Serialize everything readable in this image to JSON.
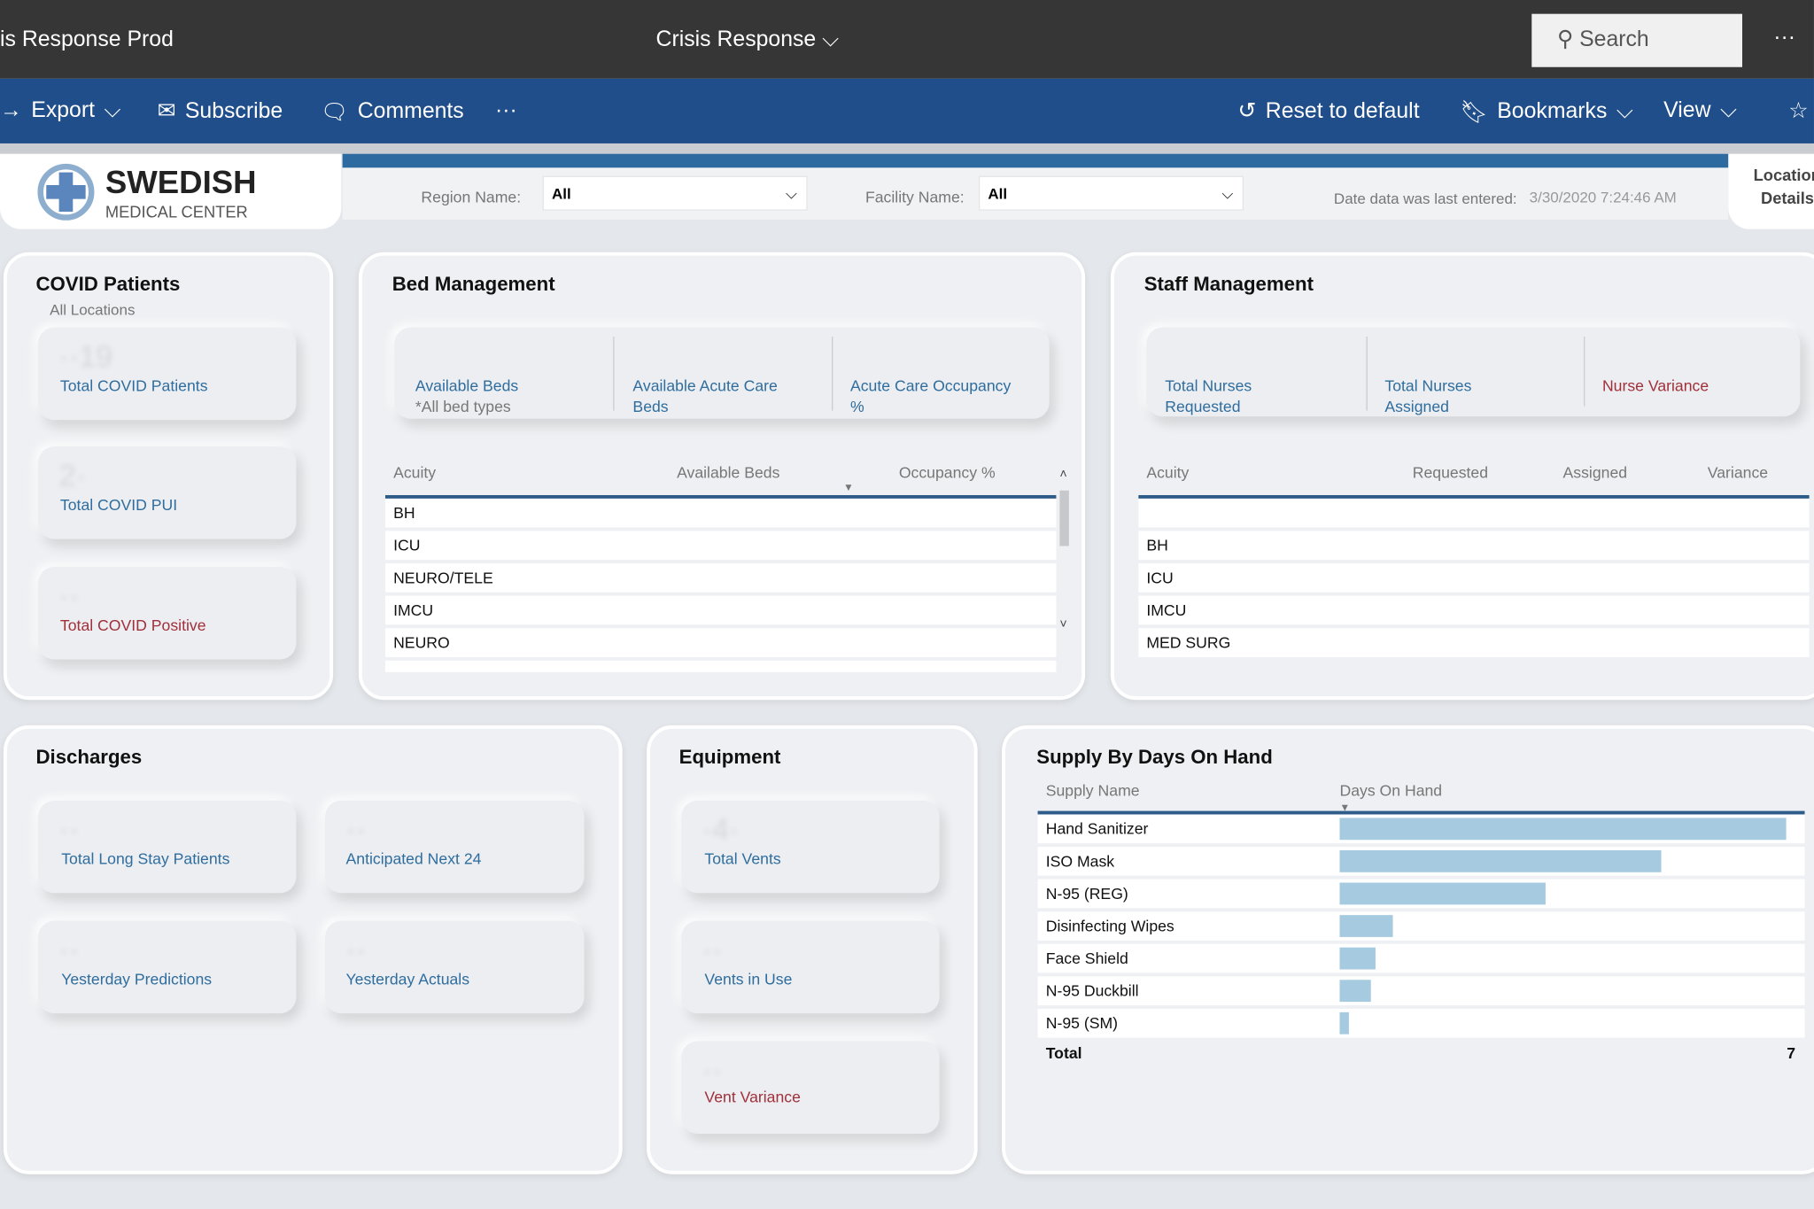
{
  "app": {
    "title": "is Response Prod",
    "report_title": "Crisis Response",
    "search_placeholder": "Search",
    "more": "···"
  },
  "toolbar": {
    "export": "Export",
    "subscribe": "Subscribe",
    "comments": "Comments",
    "more": "···",
    "reset": "Reset to default",
    "bookmarks": "Bookmarks",
    "view": "View"
  },
  "logo": {
    "name": "SWEDISH",
    "sub": "MEDICAL CENTER"
  },
  "filters": {
    "region_label": "Region Name:",
    "region_value": "All",
    "facility_label": "Facility Name:",
    "facility_value": "All",
    "date_label": "Date data was last entered:",
    "date_value": "3/30/2020 7:24:46 AM",
    "location_details_1": "Location",
    "location_details_2": "Details"
  },
  "covid": {
    "title": "COVID Patients",
    "subtitle": "All Locations",
    "cards": [
      "Total COVID Patients",
      "Total COVID PUI",
      "Total COVID Positive"
    ]
  },
  "bed": {
    "title": "Bed Management",
    "kpis": [
      {
        "l1": "Available Beds",
        "l2": "*All bed types"
      },
      {
        "l1": "Available Acute Care",
        "l2": "Beds"
      },
      {
        "l1": "Acute Care Occupancy",
        "l2": "%"
      }
    ],
    "columns": [
      "Acuity",
      "Available Beds",
      "Occupancy %"
    ],
    "rows": [
      "BH",
      "ICU",
      "NEURO/TELE",
      "IMCU",
      "NEURO"
    ]
  },
  "staff": {
    "title": "Staff Management",
    "kpis": [
      {
        "l1": "Total Nurses",
        "l2": "Requested"
      },
      {
        "l1": "Total Nurses",
        "l2": "Assigned"
      },
      {
        "l1": "Nurse Variance",
        "l2": ""
      }
    ],
    "columns": [
      "Acuity",
      "Requested",
      "Assigned",
      "Variance"
    ],
    "rows": [
      "",
      "BH",
      "ICU",
      "IMCU",
      "MED SURG"
    ]
  },
  "discharges": {
    "title": "Discharges",
    "cards": [
      "Total Long Stay Patients",
      "Anticipated Next 24",
      "Yesterday Predictions",
      "Yesterday Actuals"
    ]
  },
  "equipment": {
    "title": "Equipment",
    "cards": [
      "Total Vents",
      "Vents in Use",
      "Vent Variance"
    ]
  },
  "supply": {
    "title": "Supply By Days On Hand",
    "columns": [
      "Supply Name",
      "Days On Hand"
    ],
    "total_label": "Total",
    "total_value": "7",
    "rows": [
      {
        "name": "Hand Sanitizer",
        "fill": 1.0
      },
      {
        "name": "ISO Mask",
        "fill": 0.72
      },
      {
        "name": "N-95 (REG)",
        "fill": 0.46
      },
      {
        "name": "Disinfecting Wipes",
        "fill": 0.12
      },
      {
        "name": "Face Shield",
        "fill": 0.08
      },
      {
        "name": "N-95 Duckbill",
        "fill": 0.07
      },
      {
        "name": "N-95 (SM)",
        "fill": 0.02
      }
    ]
  },
  "colors": {
    "toolbar": "#1f4e8a",
    "topbar": "#363636",
    "accent": "#2d6aa0",
    "label": "#2f6d9e",
    "alert": "#a0303a",
    "bar": "#a6cbe0"
  }
}
